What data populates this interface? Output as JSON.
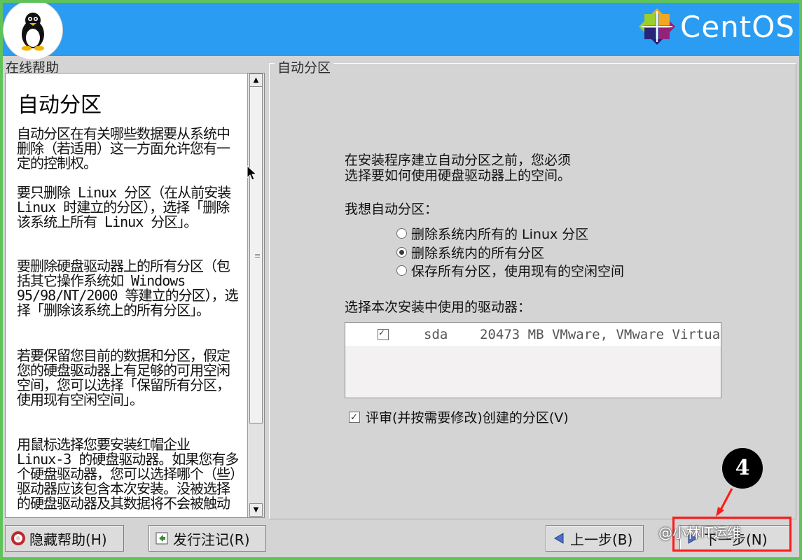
{
  "header": {
    "brand": "CentOS"
  },
  "help": {
    "panel_label": "在线帮助",
    "title": "自动分区",
    "paragraphs": [
      "自动分区在有关哪些数据要从系统中删除（若适用）这一方面允许您有一定的控制权。",
      "要只删除 Linux 分区（在从前安装 Linux 时建立的分区），选择「删除该系统上所有 Linux 分区」。",
      "要删除硬盘驱动器上的所有分区（包括其它操作系统如 Windows 95/98/NT/2000 等建立的分区），选择「删除该系统上的所有分区」。",
      "若要保留您目前的数据和分区，假定您的硬盘驱动器上有足够的可用空闲空间，您可以选择「保留所有分区，使用现有空闲空间」。",
      "用鼠标选择您要安装红帽企业 Linux-3 的硬盘驱动器。如果您有多个硬盘驱动器，您可以选择哪个（些）驱动器应该包含本次安装。没被选择的硬盘驱动器及其数据将不会被触动"
    ]
  },
  "main": {
    "panel_label": "自动分区",
    "intro_line1": "在安装程序建立自动分区之前，您必须",
    "intro_line2": "选择要如何使用硬盘驱动器上的空间。",
    "question": "我想自动分区：",
    "options": [
      {
        "label": "删除系统内所有的 Linux 分区",
        "selected": false
      },
      {
        "label": "删除系统内的所有分区",
        "selected": true
      },
      {
        "label": "保存所有分区，使用现有的空闲空间",
        "selected": false
      }
    ],
    "drives_label": "选择本次安装中使用的驱动器：",
    "drives": [
      {
        "checked": true,
        "name": "sda",
        "desc": "20473 MB VMware, VMware Virtua"
      }
    ],
    "review_label": "评审(并按需要修改)创建的分区(V)",
    "review_checked": true
  },
  "buttons": {
    "hide_help": "隐藏帮助(H)",
    "release_notes": "发行注记(R)",
    "back": "上一步(B)",
    "next": "下一步(N)"
  },
  "annotation": {
    "step_number": "4"
  },
  "watermark": "@小林IT运维",
  "colors": {
    "header": "#2a9cf2",
    "frame": "#5fc35a",
    "highlight": "#ff1a1a"
  }
}
